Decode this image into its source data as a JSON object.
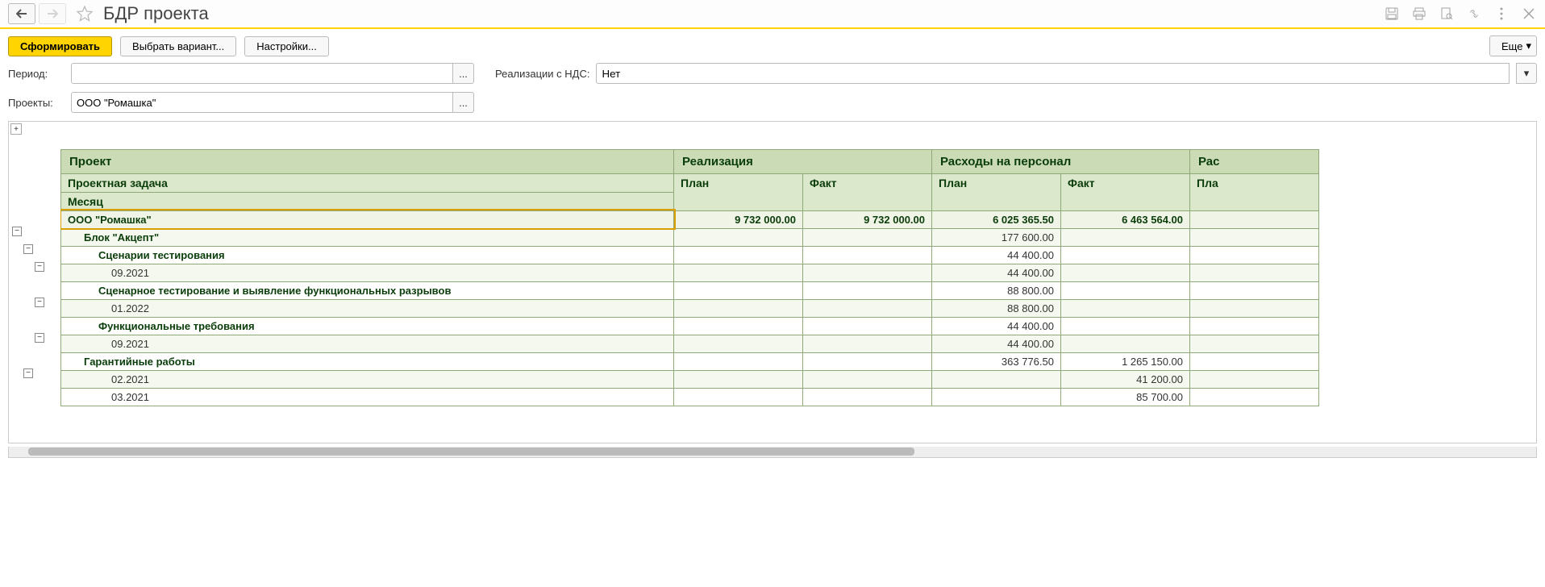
{
  "title": "БДР проекта",
  "toolbar": {
    "form": "Сформировать",
    "variant": "Выбрать вариант...",
    "settings": "Настройки...",
    "more": "Еще"
  },
  "filters": {
    "period_label": "Период:",
    "period_value": "",
    "vat_label": "Реализации с НДС:",
    "vat_value": "Нет",
    "projects_label": "Проекты:",
    "projects_value": "ООО \"Ромашка\""
  },
  "headers": {
    "project": "Проект",
    "realization": "Реализация",
    "personnel": "Расходы на персонал",
    "next_group": "Рас",
    "task": "Проектная задача",
    "month": "Месяц",
    "plan": "План",
    "fact": "Факт",
    "plan2": "Пла"
  },
  "rows": [
    {
      "lvl": 0,
      "name": "ООО \"Ромашка\"",
      "r_plan": "9 732 000.00",
      "r_fact": "9 732 000.00",
      "p_plan": "6 025 365.50",
      "p_fact": "6 463 564.00"
    },
    {
      "lvl": 1,
      "name": "Блок \"Акцепт\"",
      "r_plan": "",
      "r_fact": "",
      "p_plan": "177 600.00",
      "p_fact": ""
    },
    {
      "lvl": 2,
      "name": "Сценарии тестирования",
      "r_plan": "",
      "r_fact": "",
      "p_plan": "44 400.00",
      "p_fact": ""
    },
    {
      "lvl": 3,
      "name": "09.2021",
      "r_plan": "",
      "r_fact": "",
      "p_plan": "44 400.00",
      "p_fact": ""
    },
    {
      "lvl": 2,
      "name": "Сценарное тестирование и выявление функциональных разрывов",
      "r_plan": "",
      "r_fact": "",
      "p_plan": "88 800.00",
      "p_fact": ""
    },
    {
      "lvl": 3,
      "name": "01.2022",
      "r_plan": "",
      "r_fact": "",
      "p_plan": "88 800.00",
      "p_fact": ""
    },
    {
      "lvl": 2,
      "name": "Функциональные требования",
      "r_plan": "",
      "r_fact": "",
      "p_plan": "44 400.00",
      "p_fact": ""
    },
    {
      "lvl": 3,
      "name": "09.2021",
      "r_plan": "",
      "r_fact": "",
      "p_plan": "44 400.00",
      "p_fact": ""
    },
    {
      "lvl": 1,
      "name": "Гарантийные работы",
      "r_plan": "",
      "r_fact": "",
      "p_plan": "363 776.50",
      "p_fact": "1 265 150.00"
    },
    {
      "lvl": 3,
      "name": "02.2021",
      "r_plan": "",
      "r_fact": "",
      "p_plan": "",
      "p_fact": "41 200.00"
    },
    {
      "lvl": 3,
      "name": "03.2021",
      "r_plan": "",
      "r_fact": "",
      "p_plan": "",
      "p_fact": "85 700.00"
    }
  ],
  "tree_toggles": [
    {
      "indent": 0,
      "sym": "−"
    },
    {
      "indent": 1,
      "sym": "−"
    },
    {
      "indent": 2,
      "sym": "−"
    },
    {
      "indent": 3,
      "sym": ""
    },
    {
      "indent": 2,
      "sym": "−"
    },
    {
      "indent": 3,
      "sym": ""
    },
    {
      "indent": 2,
      "sym": "−"
    },
    {
      "indent": 3,
      "sym": ""
    },
    {
      "indent": 1,
      "sym": "−"
    },
    {
      "indent": 3,
      "sym": ""
    },
    {
      "indent": 3,
      "sym": ""
    }
  ]
}
